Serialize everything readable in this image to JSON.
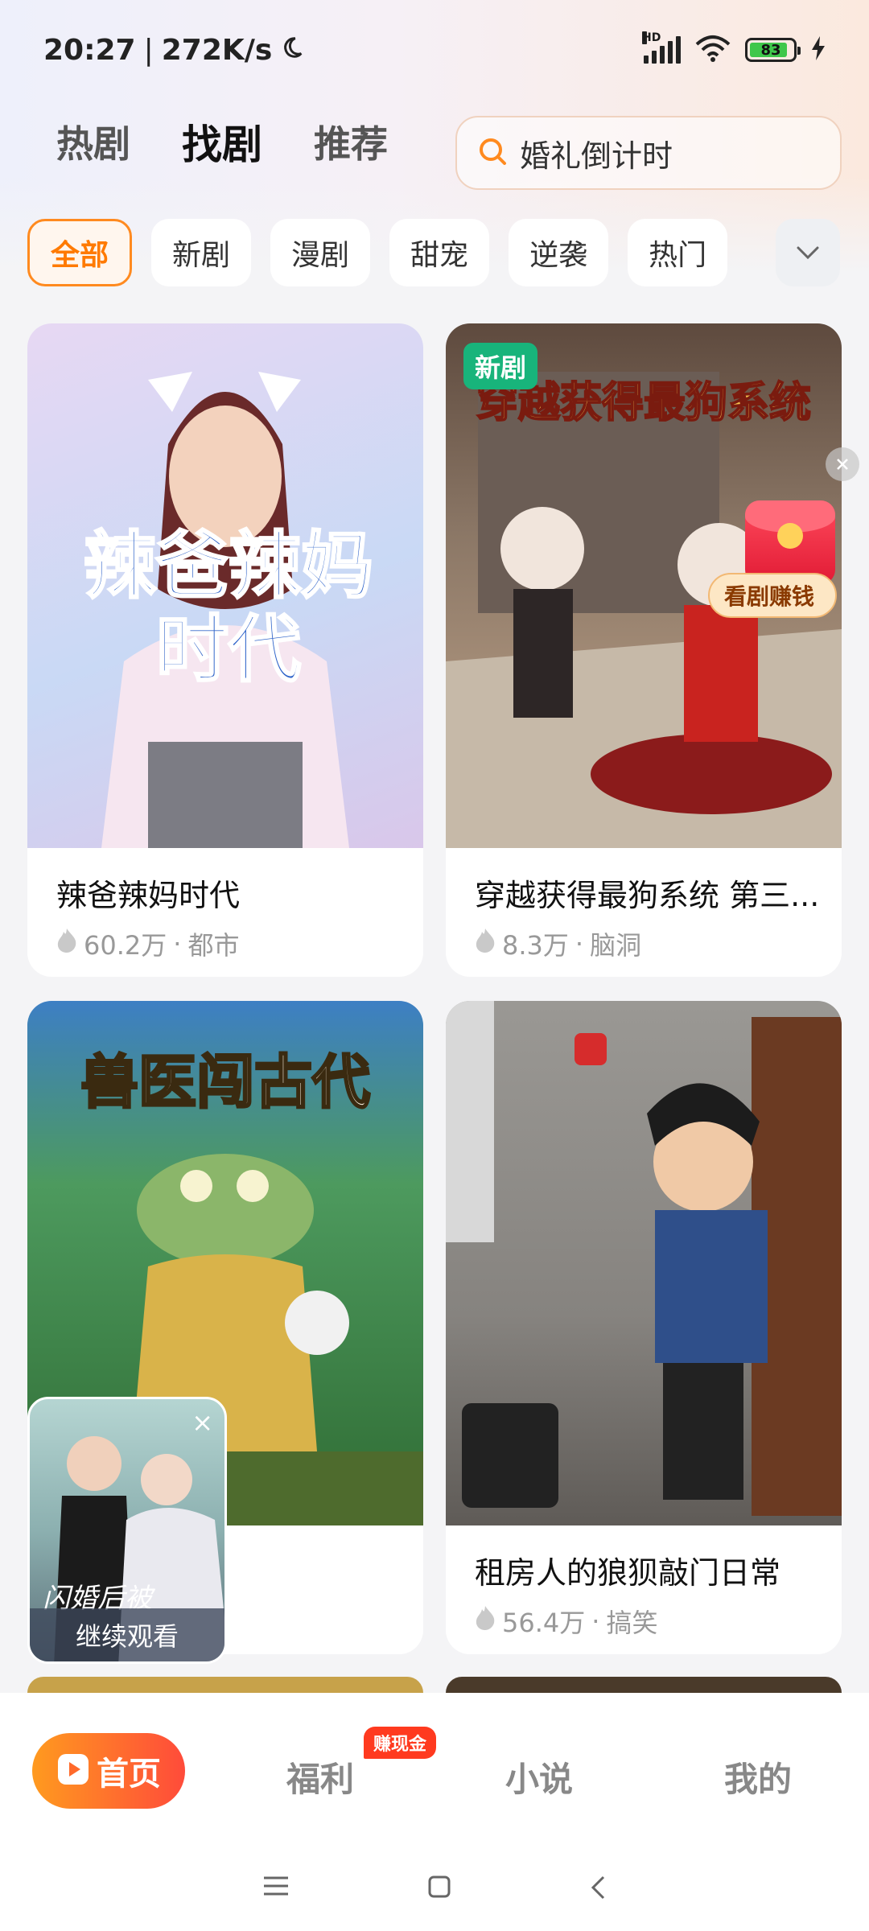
{
  "status_bar": {
    "time": "20:27",
    "speed": "272K/s",
    "battery": "83"
  },
  "top_nav": {
    "tabs": [
      "热剧",
      "找剧",
      "推荐"
    ],
    "active": "找剧"
  },
  "search": {
    "text": "婚礼倒计时"
  },
  "chips": [
    "全部",
    "新剧",
    "漫剧",
    "甜宠",
    "逆袭",
    "热门"
  ],
  "cards": [
    {
      "title": "辣爸辣妈时代",
      "views": "60.2万",
      "genre": "都市",
      "overlay": "辣爸辣妈\n时代"
    },
    {
      "title": "穿越获得最狗系统 第三...",
      "views": "8.3万",
      "genre": "脑洞",
      "badge": "新剧",
      "overlay": "穿越获得最狗系统"
    },
    {
      "title": "兽医闯古代",
      "views": "",
      "genre": "",
      "overlay": "兽医闯古代"
    },
    {
      "title": "租房人的狼狈敲门日常",
      "views": "56.4万",
      "genre": "搞笑"
    }
  ],
  "earn_widget": {
    "label": "看剧赚钱"
  },
  "mini_player": {
    "label": "继续观看",
    "caption": "闪婚后被"
  },
  "bottom_nav": {
    "home": "首页",
    "welfare": "福利",
    "welfare_badge": "赚现金",
    "novel": "小说",
    "mine": "我的"
  },
  "colors": {
    "accent": "#ff7a00",
    "new_badge": "#18b47b",
    "nav_gradient_start": "#ff9a1f",
    "nav_gradient_end": "#ff4b3a"
  }
}
